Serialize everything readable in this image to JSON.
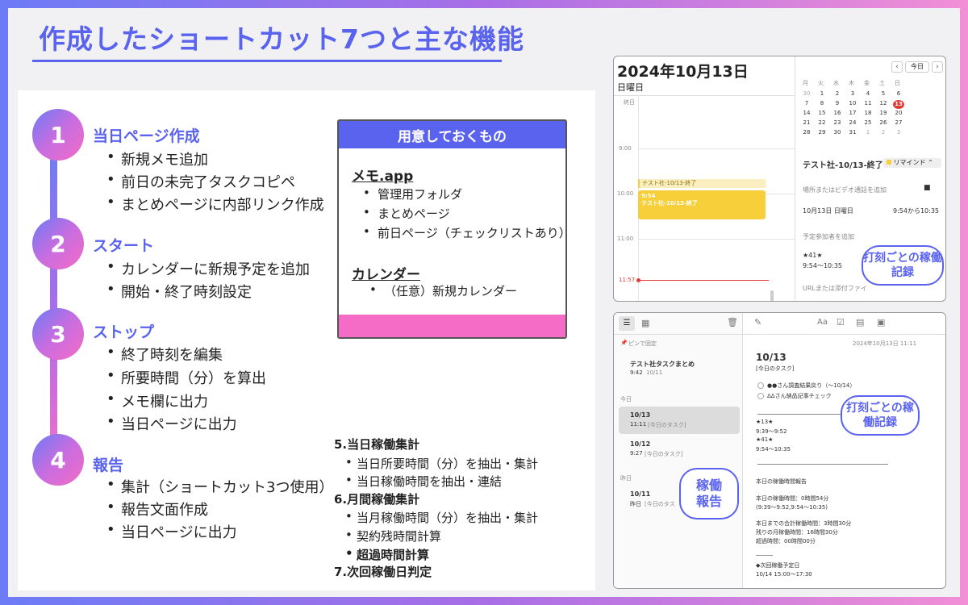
{
  "title": "作成したショートカット7つと主な機能",
  "steps": [
    {
      "num": "1",
      "title": "当日ページ作成",
      "items": [
        "新規メモ追加",
        "前日の未完了タスクコピペ",
        "まとめページに内部リンク作成"
      ]
    },
    {
      "num": "2",
      "title": "スタート",
      "items": [
        "カレンダーに新規予定を追加",
        "開始・終了時刻設定"
      ]
    },
    {
      "num": "3",
      "title": "ストップ",
      "items": [
        "終了時刻を編集",
        "所要時間（分）を算出",
        "メモ欄に出力",
        "当日ページに出力"
      ]
    },
    {
      "num": "4",
      "title": "報告",
      "items": [
        "集計（ショートカット3つ使用）",
        "報告文面作成",
        "当日ページに出力"
      ]
    }
  ],
  "prep": {
    "header": "用意しておくもの",
    "memo_title": "メモ.app",
    "memo_items": [
      "管理用フォルダ",
      "まとめページ",
      "前日ページ（チェックリストあり）"
    ],
    "cal_title": "カレンダー",
    "cal_items": [
      "（任意）新規カレンダー"
    ]
  },
  "extra": {
    "s5": "5.当日稼働集計",
    "s5_items": [
      "当日所要時間（分）を抽出・集計",
      "当日稼働時間を抽出・連結"
    ],
    "s6": "6.月間稼働集計",
    "s6_items": [
      "当月稼働時間（分）を抽出・集計",
      "契約残時間計算",
      "超過時間計算"
    ],
    "s7": "7.次回稼働日判定"
  },
  "calendar": {
    "date": "2024年10月13日",
    "weekday": "日曜日",
    "allday": "終日",
    "times": [
      "9:00",
      "10:00",
      "11:00"
    ],
    "now": "11:57",
    "event_bar": "テスト社-10/13-終了",
    "event_time": "9:54",
    "event_name": "テスト社-10/13-終了",
    "today_btn": "今日",
    "weekdays": [
      "月",
      "火",
      "水",
      "木",
      "金",
      "土",
      "日"
    ],
    "weeks": [
      [
        "30",
        "1",
        "2",
        "3",
        "4",
        "5",
        "6"
      ],
      [
        "7",
        "8",
        "9",
        "10",
        "11",
        "12",
        "13"
      ],
      [
        "14",
        "15",
        "16",
        "17",
        "18",
        "19",
        "20"
      ],
      [
        "21",
        "22",
        "23",
        "24",
        "25",
        "26",
        "27"
      ],
      [
        "28",
        "29",
        "30",
        "31",
        "1",
        "2",
        "3"
      ]
    ],
    "detail_title": "テスト社-10/13-終了",
    "reminder": "リマインド",
    "location_ph": "場所またはビデオ通話を追加",
    "detail_date": "10月13日 日曜日",
    "detail_time": "9:54から10:35",
    "invitee_ph": "予定参加者を追加",
    "note_mark": "★41★",
    "note_time": "9:54～10:35",
    "url_ph": "URLまたは添付ファイ",
    "bubble": "打刻ごとの稼働記録"
  },
  "notes": {
    "pinned": "ピンで固定",
    "pinned_note_title": "テスト社タスクまとめ",
    "pinned_note_time": "9:42",
    "pinned_note_date": "10/11",
    "today_header": "今日",
    "note1_title": "10/13",
    "note1_time": "11:11",
    "note1_sub": "[今日のタスク]",
    "note2_title": "10/12",
    "note2_time": "9:27",
    "note2_sub": "[今日のタスク]",
    "yesterday_header": "昨日",
    "note3_title": "10/11",
    "note3_time": "昨日",
    "note3_sub": "[今日のタス",
    "timestamp": "2024年10月13日 11:11",
    "doc_title": "10/13",
    "doc_sub": "[今日のタスク]",
    "check1": "●●さん調査結果戻り（～10/14）",
    "check2": "ΔΔさん納品記事チェック",
    "rec1_mark": "★13★",
    "rec1_time": "9:39～9:52",
    "rec2_mark": "★41★",
    "rec2_time": "9:54～10:35",
    "report_head": "本日の稼働時間報告",
    "report_l1": "本日の稼働時間：0時間54分",
    "report_l2": "(9:39～9:52,9:54～10:35)",
    "report_l3": "本日までの合計稼働時間：3時間30分",
    "report_l4": "残りの月稼働時間：16時間30分",
    "report_l5": "超過時間：00時間00分",
    "dashes": "―――",
    "next_head": "◆次回稼働予定日",
    "next_val": "10/14 15:00～17:30",
    "bubble_record": "打刻ごとの稼働記録",
    "bubble_report": "稼働報告",
    "font_btn": "Aa"
  },
  "colors": {
    "accent": "#5a63ee",
    "pink": "#f46cc6",
    "event": "#f7cf3a",
    "today": "#e53935"
  }
}
